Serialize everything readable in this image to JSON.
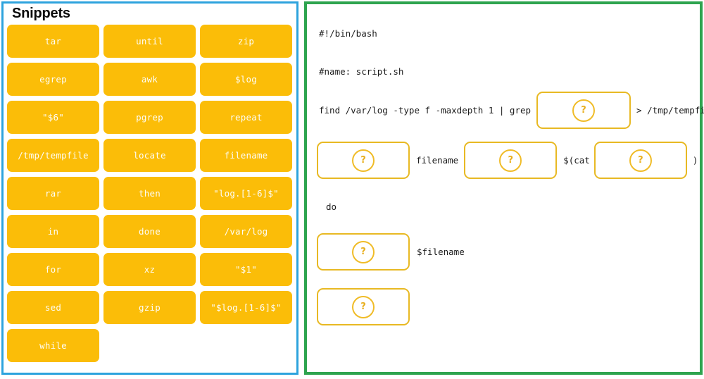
{
  "app": {
    "panels": {
      "snippets_border_color": "#2da3dd",
      "script_border_color": "#2ea44f",
      "chip_color": "#fbbd08",
      "dropzone_border_color": "#e8b923"
    }
  },
  "snippets": {
    "title": "Snippets",
    "items": [
      {
        "label": "tar"
      },
      {
        "label": "until"
      },
      {
        "label": "zip"
      },
      {
        "label": "egrep"
      },
      {
        "label": "awk"
      },
      {
        "label": "$log"
      },
      {
        "label": "\"$6\""
      },
      {
        "label": "pgrep"
      },
      {
        "label": "repeat"
      },
      {
        "label": "/tmp/tempfile"
      },
      {
        "label": "locate"
      },
      {
        "label": "filename"
      },
      {
        "label": "rar"
      },
      {
        "label": "then"
      },
      {
        "label": "\"log.[1-6]$\""
      },
      {
        "label": "in"
      },
      {
        "label": "done"
      },
      {
        "label": "/var/log"
      },
      {
        "label": "for"
      },
      {
        "label": "xz"
      },
      {
        "label": "\"$1\""
      },
      {
        "label": "sed"
      },
      {
        "label": "gzip"
      },
      {
        "label": "\"$log.[1-6]$\""
      },
      {
        "label": "while"
      }
    ]
  },
  "script": {
    "shebang": "#!/bin/bash",
    "name_comment": "#name: script.sh",
    "find_line": {
      "prefix": "find /var/log -type f -maxdepth 1 | grep",
      "dropzone_placeholder": "?",
      "suffix": "> /tmp/tempfile"
    },
    "loop_line": {
      "dropzone1_placeholder": "?",
      "label_filename": "filename",
      "dropzone2_placeholder": "?",
      "label_cat": "$(cat",
      "dropzone3_placeholder": "?",
      "label_close_paren": ")"
    },
    "do_keyword": "do",
    "echo_line": {
      "dropzone_placeholder": "?",
      "label_variable": "$filename"
    },
    "done_line": {
      "dropzone_placeholder": "?"
    }
  }
}
